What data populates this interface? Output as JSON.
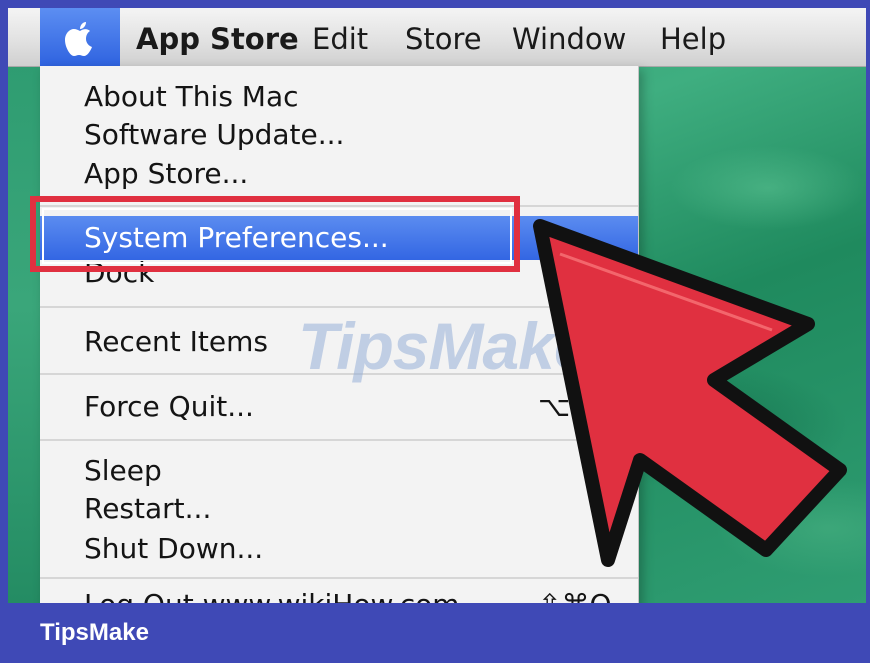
{
  "menubar": {
    "items": [
      {
        "label": "App Store"
      },
      {
        "label": "Edit"
      },
      {
        "label": "Store"
      },
      {
        "label": "Window"
      },
      {
        "label": "Help"
      }
    ]
  },
  "apple_menu": {
    "about": "About This Mac",
    "software_update": "Software Update...",
    "app_store": "App Store...",
    "system_preferences": "System Preferences...",
    "dock": "Dock",
    "recent_items": "Recent Items",
    "force_quit": "Force Quit...",
    "force_quit_shortcut": "⌥⌘⎋",
    "sleep": "Sleep",
    "restart": "Restart...",
    "shut_down": "Shut Down...",
    "log_out": "Log Out www.wikiHow.com...",
    "log_out_shortcut": "⇧⌘Q"
  },
  "watermark": "TipsMake",
  "footer": {
    "brand": "TipsMake"
  },
  "colors": {
    "menu_highlight": "#3366e3",
    "annotation_red": "#e03040",
    "frame_blue": "#3f49b6"
  },
  "icons": [
    "apple-icon",
    "pointer-arrow-icon"
  ]
}
